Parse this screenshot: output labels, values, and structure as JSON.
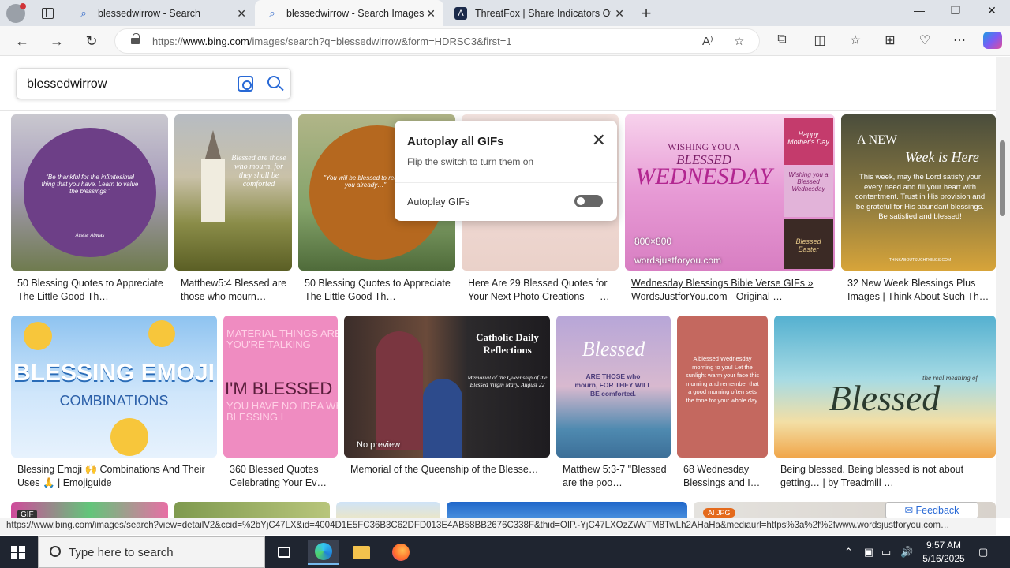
{
  "browser": {
    "tabs": [
      {
        "title": "blessedwirrow - Search",
        "icon": "search-icon",
        "active": false
      },
      {
        "title": "blessedwirrow - Search Images",
        "icon": "search-icon",
        "active": true
      },
      {
        "title": "ThreatFox | Share Indicators Of Compromise",
        "icon": "threatfox-icon",
        "active": false
      }
    ],
    "url_prefix": "https://",
    "url_host": "www.bing.com",
    "url_path": "/images/search?q=blessedwirrow&form=HDRSC3&first=1"
  },
  "search": {
    "query": "blessedwirrow"
  },
  "popup": {
    "title": "Autoplay all GIFs",
    "subtitle": "Flip the switch to turn them on",
    "toggle_label": "Autoplay GIFs",
    "toggle_on": false
  },
  "results_row1": [
    {
      "caption": "50 Blessing Quotes to Appreciate The Little Good Th…",
      "quote": "\"Be thankful for the infinitesimal thing that you have. Learn to value the blessings.\"",
      "author": "Avatar Abwas"
    },
    {
      "caption": "Matthew5:4 Blessed are those who mourn…",
      "quote": "Blessed are those who mourn, for they shall be comforted",
      "author": ""
    },
    {
      "caption": "50 Blessing Quotes to Appreciate The Little Good Th…",
      "quote": "\"You will be blessed to realize you already…\"",
      "author": ""
    },
    {
      "caption": "Here Are 29 Blessed Quotes for Your Next Photo Creations — …",
      "quote": "",
      "author": ""
    },
    {
      "caption": "Wednesday Blessings Bible Verse GIFs » WordsJustforYou.com - Original …",
      "head1": "WISHING YOU A",
      "head2": "BLESSED",
      "head3": "WEDNESDAY",
      "size": "800×800",
      "source": "wordsjustforyou.com",
      "side1": "Happy Mother's Day",
      "side2": "Wishing you a Blessed Wednesday",
      "side3": "Blessed Easter"
    },
    {
      "caption": "32 New Week Blessings Plus Images | Think About Such Th…",
      "head1": "A NEW",
      "head2": "Week is Here",
      "body": "This week, may the Lord satisfy your every need and fill your heart with contentment. Trust in His provision and be grateful for His abundant blessings. Be satisfied and blessed!",
      "source": "THINKABOUTSUCHTHINGS.COM"
    }
  ],
  "results_row2": [
    {
      "caption": "Blessing Emoji 🙌 Combinations And Their Uses 🙏 | Emojiguide",
      "head1": "BLESSING EMOJI",
      "head2": "COMBINATIONS"
    },
    {
      "caption": "360 Blessed Quotes Celebrating Your Ev…",
      "head1": "MATERIAL THINGS ARE WHAT YOU'RE TALKING",
      "head2": "I'M BLESSED",
      "head3": "YOU HAVE NO IDEA WHAT A BLESSING I"
    },
    {
      "caption": "Memorial of the Queenship of the Blesse…",
      "head1": "Catholic Daily Reflections",
      "head2": "Memorial of the Queenship of the Blessed Virgin Mary, August 22",
      "badge": "No preview"
    },
    {
      "caption": "Matthew 5:3-7 \"Blessed are the poo…",
      "head1": "Blessed",
      "head2": "ARE THOSE who mourn, FOR THEY WILL BE comforted."
    },
    {
      "caption": "68 Wednesday Blessings and I…",
      "head1": "A blessed Wednesday morning to you! Let the sunlight warm your face this morning and remember that a good morning often sets the tone for your whole day."
    },
    {
      "caption": "Being blessed. Being blessed is not about getting… | by Treadmill …",
      "head1": "the real meaning of",
      "head2": "Blessed"
    }
  ],
  "row3": {
    "gif_badge": "GIF",
    "ai_badge": "AI JPG"
  },
  "feedback_label": "Feedback",
  "status_url": "https://www.bing.com/images/search?view=detailV2&ccid=%2bYjC47LX&id=4004D1E5FC36B3C62DFD013E4AB58BB2676C338F&thid=OIP.-YjC47LXOzZWvTM8TwLh2AHaHa&mediaurl=https%3a%2f%2fwww.wordsjustforyou.com…",
  "taskbar": {
    "search_placeholder": "Type here to search",
    "time": "9:57 AM",
    "date": "5/16/2025"
  },
  "colors": {
    "accent": "#2869d6",
    "taskbar": "#1f2530"
  }
}
